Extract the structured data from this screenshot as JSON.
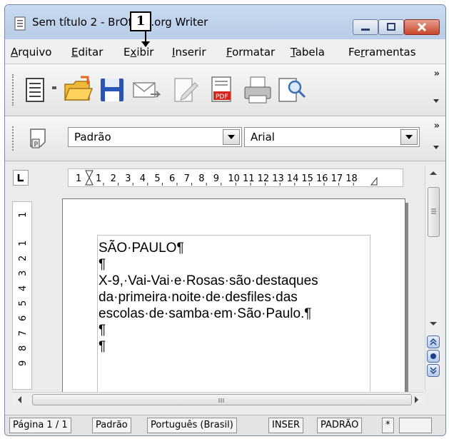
{
  "window": {
    "title": "Sem título 2 - BrOffice.org Writer"
  },
  "callout": {
    "label": "1"
  },
  "menu": [
    {
      "label": "Arquivo",
      "u": "A",
      "rest": "rquivo"
    },
    {
      "label": "Editar",
      "u": "E",
      "rest": "ditar"
    },
    {
      "label": "Exibir",
      "pre": "E",
      "u": "x",
      "rest": "ibir"
    },
    {
      "label": "Inserir",
      "u": "I",
      "rest": "nserir"
    },
    {
      "label": "Formatar",
      "u": "F",
      "rest": "ormatar"
    },
    {
      "label": "Tabela",
      "u": "T",
      "rest": "abela"
    },
    {
      "label": "Ferramentas",
      "pre": "Fe",
      "u": "r",
      "rest": "ramentas"
    }
  ],
  "toolbar": {
    "icons": [
      "new-document-icon",
      "dropdown-arrow-icon",
      "open-folder-icon",
      "save-icon",
      "email-icon",
      "edit-file-icon",
      "export-pdf-icon",
      "print-icon",
      "print-preview-icon"
    ],
    "overflow": "»"
  },
  "format": {
    "style": "Padrão",
    "font": "Arial"
  },
  "ruler": {
    "h_marks": [
      "1",
      "1",
      "2",
      "3",
      "4",
      "5",
      "6",
      "7",
      "8",
      "9",
      "10",
      "11",
      "12",
      "13",
      "14",
      "15",
      "16",
      "17",
      "18"
    ],
    "v_marks": [
      "1",
      "1",
      "2",
      "3",
      "4",
      "5",
      "6",
      "7",
      "8",
      "9"
    ]
  },
  "document": {
    "lines": [
      "SÃO·PAULO¶",
      "¶",
      "X-9,·Vai-Vai·e·Rosas·são·destaques",
      "da·primeira·noite·de·desfiles·das",
      "escolas·de·samba·em·São·Paulo.¶",
      "¶",
      "¶"
    ]
  },
  "status": {
    "page": "Página 1 / 1",
    "style": "Padrão",
    "language": "Português (Brasil)",
    "insert": "INSER",
    "selection": "PADRÃO",
    "modified": "*"
  }
}
